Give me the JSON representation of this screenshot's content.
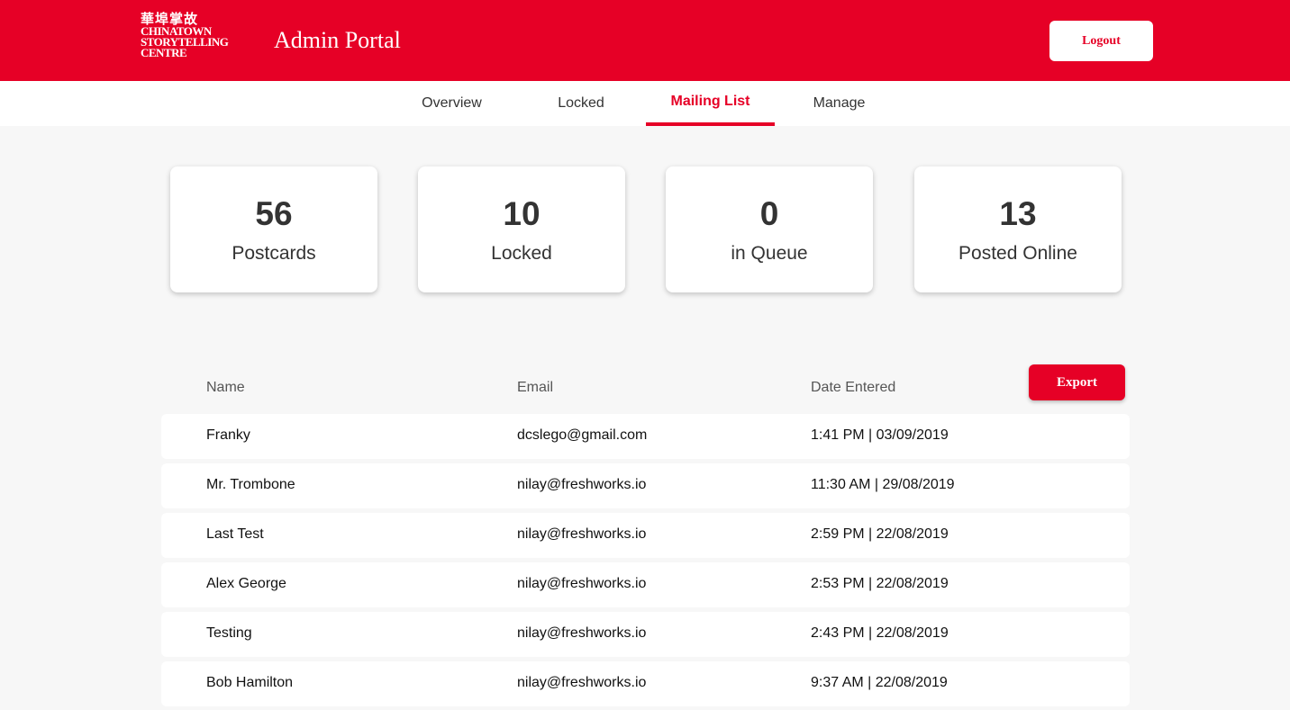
{
  "header": {
    "logo": {
      "cjk": "華埠掌故",
      "line1": "CHINATOWN",
      "line2": "STORYTELLING",
      "line3": "CENTRE"
    },
    "title": "Admin Portal",
    "logout_label": "Logout",
    "brand_color": "#e60026"
  },
  "tabs": [
    {
      "label": "Overview",
      "active": false
    },
    {
      "label": "Locked",
      "active": false
    },
    {
      "label": "Mailing List",
      "active": true
    },
    {
      "label": "Manage",
      "active": false
    }
  ],
  "stats": [
    {
      "value": "56",
      "label": "Postcards"
    },
    {
      "value": "10",
      "label": "Locked"
    },
    {
      "value": "0",
      "label": "in Queue"
    },
    {
      "value": "13",
      "label": "Posted Online"
    }
  ],
  "table": {
    "headers": {
      "name": "Name",
      "email": "Email",
      "date": "Date Entered"
    },
    "export_label": "Export",
    "rows": [
      {
        "name": "Franky",
        "email": "dcslego@gmail.com",
        "date": "1:41 PM | 03/09/2019"
      },
      {
        "name": "Mr. Trombone",
        "email": "nilay@freshworks.io",
        "date": "11:30 AM | 29/08/2019"
      },
      {
        "name": "Last Test",
        "email": "nilay@freshworks.io",
        "date": "2:59 PM | 22/08/2019"
      },
      {
        "name": "Alex George",
        "email": "nilay@freshworks.io",
        "date": "2:53 PM | 22/08/2019"
      },
      {
        "name": "Testing",
        "email": "nilay@freshworks.io",
        "date": "2:43 PM | 22/08/2019"
      },
      {
        "name": "Bob Hamilton",
        "email": "nilay@freshworks.io",
        "date": "9:37 AM | 22/08/2019"
      }
    ]
  }
}
